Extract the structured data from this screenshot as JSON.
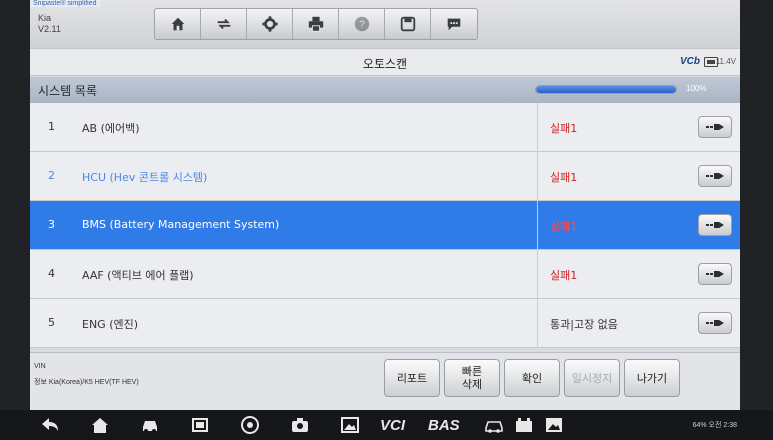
{
  "app": {
    "corner_tag": "Snipaste® simplified",
    "brand_name": "Kia",
    "version": "V2.11"
  },
  "toolbar": {
    "icons": [
      "home-icon",
      "vehicle-swap-icon",
      "gear-icon",
      "print-icon",
      "help-icon",
      "save-icon",
      "message-icon"
    ]
  },
  "title": "오토스캔",
  "status": {
    "vci_label": "VCb",
    "battery_icon": "battery-icon",
    "voltage": "11.4V"
  },
  "list": {
    "header": "시스템 목록",
    "progress_percent": 100,
    "progress_label": "100%",
    "rows": [
      {
        "num": "1",
        "name": "AB (에어백)",
        "status": "실패1",
        "status_type": "fail",
        "selected": false,
        "faded": false
      },
      {
        "num": "2",
        "name": "HCU (Hev 콘트롤 시스템)",
        "status": "실패1",
        "status_type": "fail",
        "selected": false,
        "faded": true
      },
      {
        "num": "3",
        "name": "BMS (Battery Management System)",
        "status": "실패1",
        "status_type": "fail",
        "selected": true,
        "faded": false
      },
      {
        "num": "4",
        "name": "AAF (액티브 에어 플랩)",
        "status": "실패1",
        "status_type": "fail",
        "selected": false,
        "faded": false
      },
      {
        "num": "5",
        "name": "ENG (엔진)",
        "status": "통과|고장 없음",
        "status_type": "ok",
        "selected": false,
        "faded": false
      }
    ]
  },
  "footer": {
    "vin_label": "VIN",
    "vehicle": "정보 Kia(Korea)/K5 HEV(TF HEV)",
    "buttons": {
      "report": "리포트",
      "quick_erase_line1": "빠른",
      "quick_erase_line2": "삭제",
      "confirm": "확인",
      "pause": "일시정지",
      "exit": "나가기"
    }
  },
  "navbar": {
    "vci_text": "VCI",
    "bas_text": "BAS",
    "system_status": "64% 오전 2:38"
  },
  "colors": {
    "selected_row": "#2f7be8",
    "fail_text": "#d02020",
    "progress_fill": "#2e5fc7"
  }
}
